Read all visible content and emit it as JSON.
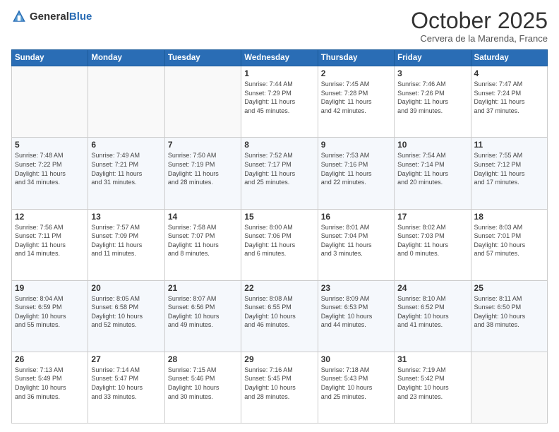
{
  "header": {
    "logo_general": "General",
    "logo_blue": "Blue",
    "month_title": "October 2025",
    "location": "Cervera de la Marenda, France"
  },
  "days_of_week": [
    "Sunday",
    "Monday",
    "Tuesday",
    "Wednesday",
    "Thursday",
    "Friday",
    "Saturday"
  ],
  "weeks": [
    [
      {
        "day": "",
        "info": ""
      },
      {
        "day": "",
        "info": ""
      },
      {
        "day": "",
        "info": ""
      },
      {
        "day": "1",
        "info": "Sunrise: 7:44 AM\nSunset: 7:29 PM\nDaylight: 11 hours\nand 45 minutes."
      },
      {
        "day": "2",
        "info": "Sunrise: 7:45 AM\nSunset: 7:28 PM\nDaylight: 11 hours\nand 42 minutes."
      },
      {
        "day": "3",
        "info": "Sunrise: 7:46 AM\nSunset: 7:26 PM\nDaylight: 11 hours\nand 39 minutes."
      },
      {
        "day": "4",
        "info": "Sunrise: 7:47 AM\nSunset: 7:24 PM\nDaylight: 11 hours\nand 37 minutes."
      }
    ],
    [
      {
        "day": "5",
        "info": "Sunrise: 7:48 AM\nSunset: 7:22 PM\nDaylight: 11 hours\nand 34 minutes."
      },
      {
        "day": "6",
        "info": "Sunrise: 7:49 AM\nSunset: 7:21 PM\nDaylight: 11 hours\nand 31 minutes."
      },
      {
        "day": "7",
        "info": "Sunrise: 7:50 AM\nSunset: 7:19 PM\nDaylight: 11 hours\nand 28 minutes."
      },
      {
        "day": "8",
        "info": "Sunrise: 7:52 AM\nSunset: 7:17 PM\nDaylight: 11 hours\nand 25 minutes."
      },
      {
        "day": "9",
        "info": "Sunrise: 7:53 AM\nSunset: 7:16 PM\nDaylight: 11 hours\nand 22 minutes."
      },
      {
        "day": "10",
        "info": "Sunrise: 7:54 AM\nSunset: 7:14 PM\nDaylight: 11 hours\nand 20 minutes."
      },
      {
        "day": "11",
        "info": "Sunrise: 7:55 AM\nSunset: 7:12 PM\nDaylight: 11 hours\nand 17 minutes."
      }
    ],
    [
      {
        "day": "12",
        "info": "Sunrise: 7:56 AM\nSunset: 7:11 PM\nDaylight: 11 hours\nand 14 minutes."
      },
      {
        "day": "13",
        "info": "Sunrise: 7:57 AM\nSunset: 7:09 PM\nDaylight: 11 hours\nand 11 minutes."
      },
      {
        "day": "14",
        "info": "Sunrise: 7:58 AM\nSunset: 7:07 PM\nDaylight: 11 hours\nand 8 minutes."
      },
      {
        "day": "15",
        "info": "Sunrise: 8:00 AM\nSunset: 7:06 PM\nDaylight: 11 hours\nand 6 minutes."
      },
      {
        "day": "16",
        "info": "Sunrise: 8:01 AM\nSunset: 7:04 PM\nDaylight: 11 hours\nand 3 minutes."
      },
      {
        "day": "17",
        "info": "Sunrise: 8:02 AM\nSunset: 7:03 PM\nDaylight: 11 hours\nand 0 minutes."
      },
      {
        "day": "18",
        "info": "Sunrise: 8:03 AM\nSunset: 7:01 PM\nDaylight: 10 hours\nand 57 minutes."
      }
    ],
    [
      {
        "day": "19",
        "info": "Sunrise: 8:04 AM\nSunset: 6:59 PM\nDaylight: 10 hours\nand 55 minutes."
      },
      {
        "day": "20",
        "info": "Sunrise: 8:05 AM\nSunset: 6:58 PM\nDaylight: 10 hours\nand 52 minutes."
      },
      {
        "day": "21",
        "info": "Sunrise: 8:07 AM\nSunset: 6:56 PM\nDaylight: 10 hours\nand 49 minutes."
      },
      {
        "day": "22",
        "info": "Sunrise: 8:08 AM\nSunset: 6:55 PM\nDaylight: 10 hours\nand 46 minutes."
      },
      {
        "day": "23",
        "info": "Sunrise: 8:09 AM\nSunset: 6:53 PM\nDaylight: 10 hours\nand 44 minutes."
      },
      {
        "day": "24",
        "info": "Sunrise: 8:10 AM\nSunset: 6:52 PM\nDaylight: 10 hours\nand 41 minutes."
      },
      {
        "day": "25",
        "info": "Sunrise: 8:11 AM\nSunset: 6:50 PM\nDaylight: 10 hours\nand 38 minutes."
      }
    ],
    [
      {
        "day": "26",
        "info": "Sunrise: 7:13 AM\nSunset: 5:49 PM\nDaylight: 10 hours\nand 36 minutes."
      },
      {
        "day": "27",
        "info": "Sunrise: 7:14 AM\nSunset: 5:47 PM\nDaylight: 10 hours\nand 33 minutes."
      },
      {
        "day": "28",
        "info": "Sunrise: 7:15 AM\nSunset: 5:46 PM\nDaylight: 10 hours\nand 30 minutes."
      },
      {
        "day": "29",
        "info": "Sunrise: 7:16 AM\nSunset: 5:45 PM\nDaylight: 10 hours\nand 28 minutes."
      },
      {
        "day": "30",
        "info": "Sunrise: 7:18 AM\nSunset: 5:43 PM\nDaylight: 10 hours\nand 25 minutes."
      },
      {
        "day": "31",
        "info": "Sunrise: 7:19 AM\nSunset: 5:42 PM\nDaylight: 10 hours\nand 23 minutes."
      },
      {
        "day": "",
        "info": ""
      }
    ]
  ]
}
